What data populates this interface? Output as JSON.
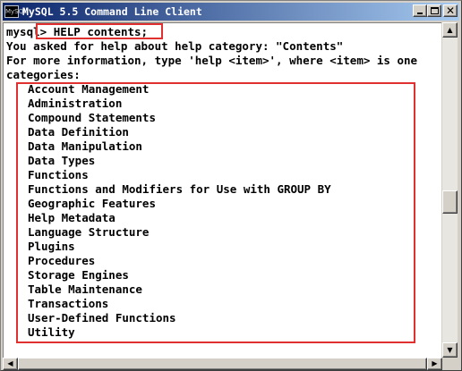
{
  "window": {
    "title": "MySQL 5.5 Command Line Client",
    "icon_text": "MySQL",
    "icons": {
      "minimize": "minimize-icon",
      "maximize": "maximize-icon",
      "close": "close-icon"
    }
  },
  "console": {
    "prompt": "mysql> ",
    "command": "HELP contents;",
    "response_lines": [
      "You asked for help about help category: \"Contents\"",
      "For more information, type 'help <item>', where <item> is one",
      "categories:"
    ],
    "categories": [
      "Account Management",
      "Administration",
      "Compound Statements",
      "Data Definition",
      "Data Manipulation",
      "Data Types",
      "Functions",
      "Functions and Modifiers for Use with GROUP BY",
      "Geographic Features",
      "Help Metadata",
      "Language Structure",
      "Plugins",
      "Procedures",
      "Storage Engines",
      "Table Maintenance",
      "Transactions",
      "User-Defined Functions",
      "Utility"
    ]
  },
  "colors": {
    "titlebar_start": "#0a246a",
    "titlebar_end": "#a6caf0",
    "highlight": "#e03030",
    "console_bg": "#ffffff",
    "console_text": "#000000"
  }
}
